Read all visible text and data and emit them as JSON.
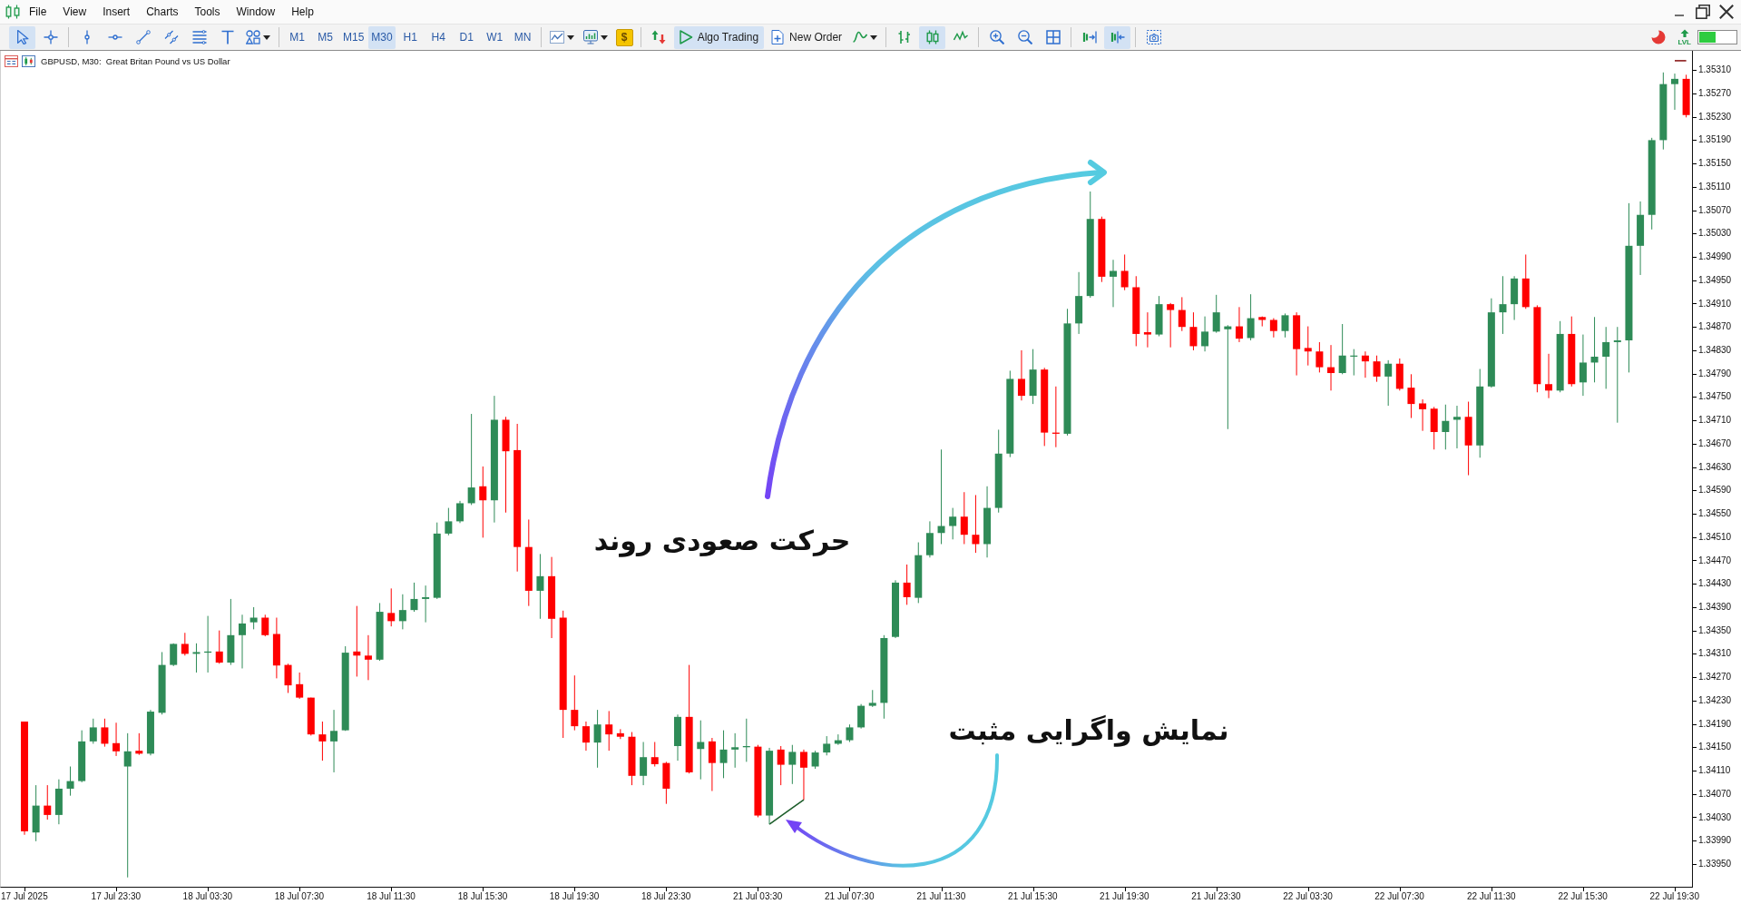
{
  "window": {
    "menu": [
      "File",
      "View",
      "Insert",
      "Charts",
      "Tools",
      "Window",
      "Help"
    ]
  },
  "toolbar": {
    "tools": [
      {
        "selected": true
      },
      {
        "selected": false
      },
      {
        "selected": false
      },
      {
        "selected": false
      },
      {
        "selected": false
      },
      {
        "selected": false
      },
      {
        "selected": false
      },
      {
        "selected": false
      },
      {
        "selected": false
      }
    ],
    "timeframes": [
      {
        "label": "M1",
        "selected": false
      },
      {
        "label": "M5",
        "selected": false
      },
      {
        "label": "M15",
        "selected": false
      },
      {
        "label": "M30",
        "selected": true
      },
      {
        "label": "H1",
        "selected": false
      },
      {
        "label": "H4",
        "selected": false
      },
      {
        "label": "D1",
        "selected": false
      },
      {
        "label": "W1",
        "selected": false
      },
      {
        "label": "MN",
        "selected": false
      }
    ],
    "market_button": {
      "label": "$"
    },
    "algo_trading": {
      "label": "Algo Trading",
      "on": true
    },
    "new_order": {
      "label": "New Order"
    },
    "chart_types": [
      {
        "selected": false
      },
      {
        "selected": true
      },
      {
        "selected": false
      }
    ],
    "scroll_buttons": [
      {
        "selected": false
      },
      {
        "selected": true
      }
    ],
    "level_button": {
      "label": "LVL"
    }
  },
  "chart": {
    "chart_data": {
      "type": "candlestick",
      "title": "GBPUSD, M30:  Great Britan Pound vs US Dollar",
      "categories": [
        "17 Jul 2025",
        null,
        null,
        null,
        null,
        null,
        null,
        null,
        "17 Jul 23:30",
        null,
        null,
        null,
        null,
        null,
        null,
        null,
        "18 Jul 03:30",
        null,
        null,
        null,
        null,
        null,
        null,
        null,
        "18 Jul 07:30",
        null,
        null,
        null,
        null,
        null,
        null,
        null,
        "18 Jul 11:30",
        null,
        null,
        null,
        null,
        null,
        null,
        null,
        "18 Jul 15:30",
        null,
        null,
        null,
        null,
        null,
        null,
        null,
        "18 Jul 19:30",
        null,
        null,
        null,
        null,
        null,
        null,
        null,
        "18 Jul 23:30",
        null,
        null,
        null,
        null,
        null,
        null,
        null,
        "21 Jul 03:30",
        null,
        null,
        null,
        null,
        null,
        null,
        null,
        "21 Jul 07:30",
        null,
        null,
        null,
        null,
        null,
        null,
        null,
        "21 Jul 11:30",
        null,
        null,
        null,
        null,
        null,
        null,
        null,
        "21 Jul 15:30",
        null,
        null,
        null,
        null,
        null,
        null,
        null,
        "21 Jul 19:30",
        null,
        null,
        null,
        null,
        null,
        null,
        null,
        "21 Jul 23:30",
        null,
        null,
        null,
        null,
        null,
        null,
        null,
        "22 Jul 03:30",
        null,
        null,
        null,
        null,
        null,
        null,
        null,
        "22 Jul 07:30",
        null,
        null,
        null,
        null,
        null,
        null,
        null,
        "22 Jul 11:30",
        null,
        null,
        null,
        null,
        null,
        null,
        null,
        "22 Jul 15:30",
        null,
        null,
        null,
        null,
        null,
        null,
        null,
        "22 Jul 19:30",
        null
      ],
      "ohlc": [
        [
          1.34194,
          1.34194,
          1.34,
          1.34006
        ],
        [
          1.34004,
          1.34085,
          1.33989,
          1.3405
        ],
        [
          1.3405,
          1.34085,
          1.34026,
          1.34034
        ],
        [
          1.34034,
          1.34095,
          1.34018,
          1.34079
        ],
        [
          1.34079,
          1.34117,
          1.34067,
          1.34092
        ],
        [
          1.34092,
          1.34179,
          1.3409,
          1.3416
        ],
        [
          1.3416,
          1.34199,
          1.34156,
          1.34184
        ],
        [
          1.34184,
          1.34199,
          1.34151,
          1.34156
        ],
        [
          1.34157,
          1.34192,
          1.34135,
          1.34143
        ],
        [
          1.34117,
          1.34174,
          1.33927,
          1.34143
        ],
        [
          1.34144,
          1.34174,
          1.34137,
          1.34139
        ],
        [
          1.34139,
          1.34214,
          1.34136,
          1.34211
        ],
        [
          1.34209,
          1.34313,
          1.34206,
          1.34291
        ],
        [
          1.34291,
          1.34328,
          1.34289,
          1.34327
        ],
        [
          1.34327,
          1.34346,
          1.34307,
          1.3431
        ],
        [
          1.3431,
          1.34328,
          1.34278,
          1.34313
        ],
        [
          1.34312,
          1.34375,
          1.34278,
          1.34314
        ],
        [
          1.34314,
          1.3435,
          1.34293,
          1.34295
        ],
        [
          1.34295,
          1.34404,
          1.34291,
          1.34342
        ],
        [
          1.34342,
          1.34377,
          1.34285,
          1.34362
        ],
        [
          1.34364,
          1.3439,
          1.34352,
          1.34372
        ],
        [
          1.34372,
          1.34377,
          1.3434,
          1.34342
        ],
        [
          1.34344,
          1.34372,
          1.34268,
          1.3429
        ],
        [
          1.34291,
          1.34293,
          1.34243,
          1.34256
        ],
        [
          1.34258,
          1.34278,
          1.34233,
          1.34235
        ],
        [
          1.34235,
          1.34235,
          1.3417,
          1.34172
        ],
        [
          1.34172,
          1.34194,
          1.34127,
          1.3416
        ],
        [
          1.3416,
          1.34214,
          1.34107,
          1.34178
        ],
        [
          1.34179,
          1.34323,
          1.34178,
          1.34312
        ],
        [
          1.34314,
          1.34392,
          1.34271,
          1.34307
        ],
        [
          1.34307,
          1.34342,
          1.34265,
          1.343
        ],
        [
          1.343,
          1.34397,
          1.34298,
          1.34382
        ],
        [
          1.3438,
          1.34422,
          1.34357,
          1.34366
        ],
        [
          1.34366,
          1.34412,
          1.34352,
          1.34385
        ],
        [
          1.34385,
          1.34432,
          1.34382,
          1.34404
        ],
        [
          1.34404,
          1.34427,
          1.34364,
          1.34407
        ],
        [
          1.34406,
          1.34535,
          1.34404,
          1.34516
        ],
        [
          1.34516,
          1.3456,
          1.34513,
          1.34537
        ],
        [
          1.34537,
          1.34572,
          1.34534,
          1.34568
        ],
        [
          1.34568,
          1.34721,
          1.34565,
          1.34595
        ],
        [
          1.34597,
          1.34631,
          1.34509,
          1.34573
        ],
        [
          1.34573,
          1.34752,
          1.34535,
          1.34711
        ],
        [
          1.34711,
          1.34716,
          1.34552,
          1.34657
        ],
        [
          1.34659,
          1.34704,
          1.34451,
          1.34493
        ],
        [
          1.34493,
          1.3454,
          1.34392,
          1.34418
        ],
        [
          1.34418,
          1.34481,
          1.3437,
          1.34443
        ],
        [
          1.34443,
          1.34476,
          1.34337,
          1.3437
        ],
        [
          1.34372,
          1.34384,
          1.34166,
          1.34214
        ],
        [
          1.34214,
          1.34273,
          1.34179,
          1.34186
        ],
        [
          1.34186,
          1.34194,
          1.34144,
          1.34158
        ],
        [
          1.34158,
          1.34214,
          1.34115,
          1.34189
        ],
        [
          1.34189,
          1.34212,
          1.34144,
          1.34172
        ],
        [
          1.34174,
          1.34181,
          1.34164,
          1.34168
        ],
        [
          1.34168,
          1.34176,
          1.34085,
          1.34101
        ],
        [
          1.34101,
          1.34159,
          1.34085,
          1.34133
        ],
        [
          1.34133,
          1.34159,
          1.34117,
          1.34121
        ],
        [
          1.34123,
          1.34125,
          1.34053,
          1.34079
        ],
        [
          1.34152,
          1.34206,
          1.34127,
          1.34202
        ],
        [
          1.34202,
          1.34291,
          1.34105,
          1.34107
        ],
        [
          1.34147,
          1.34196,
          1.34095,
          1.34159
        ],
        [
          1.3416,
          1.34166,
          1.34075,
          1.34123
        ],
        [
          1.34123,
          1.34179,
          1.34097,
          1.34146
        ],
        [
          1.34146,
          1.34174,
          1.34115,
          1.3415
        ],
        [
          1.3415,
          1.34199,
          1.34125,
          1.34152
        ],
        [
          1.34151,
          1.34154,
          1.3403,
          1.34033
        ],
        [
          1.34033,
          1.34149,
          1.34018,
          1.34144
        ],
        [
          1.34146,
          1.34152,
          1.34085,
          1.3412
        ],
        [
          1.3412,
          1.34154,
          1.34087,
          1.34142
        ],
        [
          1.34142,
          1.34146,
          1.3406,
          1.34115
        ],
        [
          1.34117,
          1.34144,
          1.34113,
          1.34141
        ],
        [
          1.34141,
          1.34169,
          1.34136,
          1.34156
        ],
        [
          1.34156,
          1.34172,
          1.34154,
          1.34162
        ],
        [
          1.34162,
          1.34189,
          1.34159,
          1.34184
        ],
        [
          1.34184,
          1.34224,
          1.34182,
          1.34221
        ],
        [
          1.34221,
          1.34248,
          1.34219,
          1.34226
        ],
        [
          1.34226,
          1.34342,
          1.34199,
          1.34337
        ],
        [
          1.34339,
          1.34436,
          1.34337,
          1.34432
        ],
        [
          1.34432,
          1.34463,
          1.34394,
          1.34407
        ],
        [
          1.34406,
          1.34501,
          1.34397,
          1.34479
        ],
        [
          1.34479,
          1.34537,
          1.34475,
          1.34517
        ],
        [
          1.34517,
          1.3466,
          1.34498,
          1.34529
        ],
        [
          1.34529,
          1.3456,
          1.34506,
          1.34545
        ],
        [
          1.34545,
          1.34587,
          1.34498,
          1.34514
        ],
        [
          1.34514,
          1.34582,
          1.34483,
          1.34498
        ],
        [
          1.34498,
          1.34597,
          1.34475,
          1.3456
        ],
        [
          1.3456,
          1.34694,
          1.34552,
          1.34653
        ],
        [
          1.34653,
          1.34795,
          1.34647,
          1.34781
        ],
        [
          1.34781,
          1.3483,
          1.34744,
          1.34752
        ],
        [
          1.34752,
          1.34832,
          1.34738,
          1.34797
        ],
        [
          1.34797,
          1.348,
          1.34666,
          1.34689
        ],
        [
          1.34689,
          1.34768,
          1.34664,
          1.34687
        ],
        [
          1.34687,
          1.34901,
          1.34684,
          1.34876
        ],
        [
          1.34876,
          1.34964,
          1.34858,
          1.34923
        ],
        [
          1.34923,
          1.35102,
          1.3492,
          1.35055
        ],
        [
          1.35055,
          1.35059,
          1.34947,
          1.34956
        ],
        [
          1.34956,
          1.34985,
          1.34904,
          1.34966
        ],
        [
          1.34966,
          1.34994,
          1.34933,
          1.34938
        ],
        [
          1.34938,
          1.34957,
          1.34837,
          1.34858
        ],
        [
          1.34861,
          1.34895,
          1.34835,
          1.34857
        ],
        [
          1.34857,
          1.34923,
          1.34854,
          1.34909
        ],
        [
          1.34909,
          1.34911,
          1.34835,
          1.34899
        ],
        [
          1.34899,
          1.34921,
          1.34863,
          1.3487
        ],
        [
          1.3487,
          1.34895,
          1.3483,
          1.34837
        ],
        [
          1.34837,
          1.34888,
          1.34828,
          1.34862
        ],
        [
          1.34862,
          1.34925,
          1.3486,
          1.34895
        ],
        [
          1.34866,
          1.34873,
          1.34695,
          1.34871
        ],
        [
          1.34871,
          1.34904,
          1.34844,
          1.3485
        ],
        [
          1.34851,
          1.34926,
          1.34847,
          1.34885
        ],
        [
          1.34887,
          1.34888,
          1.34871,
          1.34882
        ],
        [
          1.34882,
          1.34885,
          1.34852,
          1.34863
        ],
        [
          1.34863,
          1.34893,
          1.34852,
          1.3489
        ],
        [
          1.3489,
          1.34895,
          1.34787,
          1.34832
        ],
        [
          1.34834,
          1.34871,
          1.34804,
          1.34828
        ],
        [
          1.34828,
          1.34844,
          1.34792,
          1.34801
        ],
        [
          1.34801,
          1.34839,
          1.34761,
          1.34791
        ],
        [
          1.34791,
          1.34875,
          1.34789,
          1.34821
        ],
        [
          1.3482,
          1.34832,
          1.34787,
          1.34821
        ],
        [
          1.34821,
          1.34828,
          1.34783,
          1.34811
        ],
        [
          1.34811,
          1.34821,
          1.34776,
          1.34785
        ],
        [
          1.34785,
          1.34813,
          1.34735,
          1.34807
        ],
        [
          1.34807,
          1.34816,
          1.34761,
          1.34764
        ],
        [
          1.34766,
          1.34789,
          1.34714,
          1.34738
        ],
        [
          1.34739,
          1.34746,
          1.34692,
          1.34729
        ],
        [
          1.3473,
          1.34733,
          1.3466,
          1.3469
        ],
        [
          1.3469,
          1.34737,
          1.3466,
          1.34709
        ],
        [
          1.34711,
          1.34735,
          1.34662,
          1.34716
        ],
        [
          1.34716,
          1.34742,
          1.34616,
          1.34667
        ],
        [
          1.34667,
          1.34798,
          1.34646,
          1.34768
        ],
        [
          1.34768,
          1.34919,
          1.34766,
          1.34895
        ],
        [
          1.34895,
          1.34957,
          1.34858,
          1.34909
        ],
        [
          1.34909,
          1.34957,
          1.34882,
          1.34953
        ],
        [
          1.34953,
          1.34994,
          1.34901,
          1.34904
        ],
        [
          1.34904,
          1.34907,
          1.34758,
          1.34772
        ],
        [
          1.34772,
          1.34824,
          1.34748,
          1.34761
        ],
        [
          1.34761,
          1.3488,
          1.34758,
          1.34858
        ],
        [
          1.34858,
          1.34888,
          1.34768,
          1.34772
        ],
        [
          1.34775,
          1.34857,
          1.34752,
          1.34809
        ],
        [
          1.34809,
          1.34887,
          1.34775,
          1.34819
        ],
        [
          1.34819,
          1.3487,
          1.34764,
          1.34844
        ],
        [
          1.34844,
          1.3487,
          1.34706,
          1.34847
        ],
        [
          1.34847,
          1.35082,
          1.34792,
          1.35009
        ],
        [
          1.35009,
          1.35085,
          1.34959,
          1.35062
        ],
        [
          1.35062,
          1.35194,
          1.35037,
          1.3519
        ],
        [
          1.3519,
          1.35306,
          1.35174,
          1.35286
        ],
        [
          1.35286,
          1.35304,
          1.35242,
          1.35295
        ],
        [
          1.35295,
          1.35302,
          1.35229,
          1.35233
        ]
      ],
      "series": [
        {
          "type": "line",
          "color": "#1d5e2b",
          "values": [
            null,
            null,
            null,
            null,
            null,
            null,
            null,
            null,
            null,
            null,
            null,
            null,
            null,
            null,
            null,
            null,
            null,
            null,
            null,
            null,
            null,
            null,
            null,
            null,
            null,
            null,
            null,
            null,
            null,
            null,
            null,
            null,
            null,
            null,
            null,
            null,
            null,
            null,
            null,
            null,
            null,
            null,
            null,
            null,
            null,
            null,
            null,
            null,
            null,
            null,
            null,
            null,
            null,
            null,
            null,
            null,
            null,
            null,
            null,
            null,
            null,
            null,
            null,
            null,
            null,
            1.34018,
            1.34032,
            1.34046,
            1.3406,
            null,
            null,
            null,
            null,
            null,
            null,
            null,
            null,
            null,
            null,
            null,
            null,
            null,
            null,
            null,
            null,
            null,
            null,
            null,
            null,
            null,
            null,
            null,
            null,
            null,
            null,
            null,
            null,
            null,
            null,
            null,
            null,
            null,
            null,
            null,
            null,
            null,
            null,
            null,
            null,
            null,
            null,
            null,
            null,
            null,
            null,
            null,
            null,
            null,
            null,
            null,
            null,
            null,
            null,
            null,
            null,
            null,
            null,
            null,
            null,
            null,
            null,
            null,
            null,
            null,
            null,
            null,
            null,
            null,
            null,
            null,
            null,
            null,
            null,
            null,
            null,
            null
          ]
        },
        {
          "type": "line",
          "color": "#8b1a1a",
          "values": [
            null,
            null,
            null,
            null,
            null,
            null,
            null,
            null,
            null,
            null,
            null,
            null,
            null,
            null,
            null,
            null,
            null,
            null,
            null,
            null,
            null,
            null,
            null,
            null,
            null,
            null,
            null,
            null,
            null,
            null,
            null,
            null,
            null,
            null,
            null,
            null,
            null,
            null,
            null,
            null,
            null,
            null,
            null,
            null,
            null,
            null,
            null,
            null,
            null,
            null,
            null,
            null,
            null,
            null,
            null,
            null,
            null,
            null,
            null,
            null,
            null,
            null,
            null,
            null,
            null,
            null,
            null,
            null,
            null,
            null,
            null,
            null,
            null,
            null,
            null,
            null,
            null,
            null,
            null,
            null,
            null,
            null,
            null,
            null,
            null,
            null,
            null,
            null,
            null,
            null,
            null,
            null,
            null,
            null,
            null,
            null,
            null,
            null,
            null,
            null,
            null,
            null,
            null,
            null,
            null,
            null,
            null,
            null,
            null,
            null,
            null,
            null,
            null,
            null,
            null,
            null,
            null,
            null,
            null,
            null,
            null,
            null,
            null,
            null,
            null,
            null,
            null,
            null,
            null,
            null,
            null,
            null,
            null,
            null,
            null,
            null,
            null,
            null,
            null,
            null,
            null,
            null,
            null,
            null,
            1.35326,
            1.35326
          ]
        }
      ],
      "ylim": [
        1.33911,
        1.35343
      ],
      "yticks": [
        {
          "value": 1.3531,
          "label": "1.35310"
        },
        {
          "value": 1.3527,
          "label": "1.35270"
        },
        {
          "value": 1.3523,
          "label": "1.35230"
        },
        {
          "value": 1.3519,
          "label": "1.35190"
        },
        {
          "value": 1.3515,
          "label": "1.35150"
        },
        {
          "value": 1.3511,
          "label": "1.35110"
        },
        {
          "value": 1.3507,
          "label": "1.35070"
        },
        {
          "value": 1.3503,
          "label": "1.35030"
        },
        {
          "value": 1.3499,
          "label": "1.34990"
        },
        {
          "value": 1.3495,
          "label": "1.34950"
        },
        {
          "value": 1.3491,
          "label": "1.34910"
        },
        {
          "value": 1.3487,
          "label": "1.34870"
        },
        {
          "value": 1.3483,
          "label": "1.34830"
        },
        {
          "value": 1.3479,
          "label": "1.34790"
        },
        {
          "value": 1.3475,
          "label": "1.34750"
        },
        {
          "value": 1.3471,
          "label": "1.34710"
        },
        {
          "value": 1.3467,
          "label": "1.34670"
        },
        {
          "value": 1.3463,
          "label": "1.34630"
        },
        {
          "value": 1.3459,
          "label": "1.34590"
        },
        {
          "value": 1.3455,
          "label": "1.34550"
        },
        {
          "value": 1.3451,
          "label": "1.34510"
        },
        {
          "value": 1.3447,
          "label": "1.34470"
        },
        {
          "value": 1.3443,
          "label": "1.34430"
        },
        {
          "value": 1.3439,
          "label": "1.34390"
        },
        {
          "value": 1.3435,
          "label": "1.34350"
        },
        {
          "value": 1.3431,
          "label": "1.34310"
        },
        {
          "value": 1.3427,
          "label": "1.34270"
        },
        {
          "value": 1.3423,
          "label": "1.34230"
        },
        {
          "value": 1.3419,
          "label": "1.34190"
        },
        {
          "value": 1.3415,
          "label": "1.34150"
        },
        {
          "value": 1.3411,
          "label": "1.34110"
        },
        {
          "value": 1.3407,
          "label": "1.34070"
        },
        {
          "value": 1.3403,
          "label": "1.34030"
        },
        {
          "value": 1.3399,
          "label": "1.33990"
        },
        {
          "value": 1.3395,
          "label": "1.33950"
        }
      ],
      "annotations": [
        "حرکت صعودی روند",
        "نمایش واگرایی مثبت"
      ]
    }
  }
}
